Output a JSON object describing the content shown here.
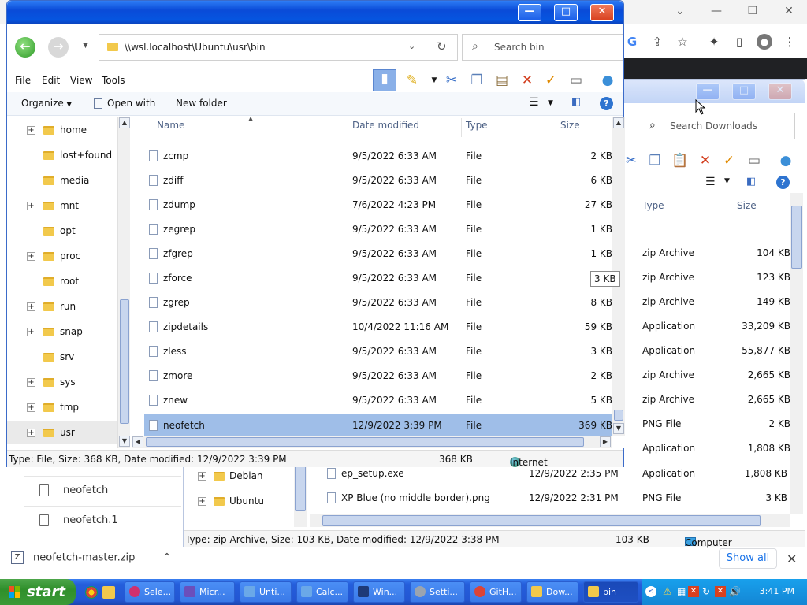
{
  "chrome": {
    "download_file": "neofetch-master.zip",
    "show_all": "Show all",
    "list": [
      "neofetch",
      "neofetch.1"
    ],
    "toolbar_icons": [
      "google-icon",
      "share-icon",
      "star-icon",
      "extensions-icon",
      "sidepanel-icon",
      "profile-icon",
      "menu-icon"
    ]
  },
  "win1": {
    "address": "\\\\wsl.localhost\\Ubuntu\\usr\\bin",
    "search_placeholder": "Search bin",
    "menu": [
      "File",
      "Edit",
      "View",
      "Tools"
    ],
    "organize": "Organize",
    "open_with": "Open with",
    "new_folder": "New folder",
    "tree": [
      {
        "label": "home",
        "expand": "+"
      },
      {
        "label": "lost+found",
        "expand": ""
      },
      {
        "label": "media",
        "expand": ""
      },
      {
        "label": "mnt",
        "expand": "+"
      },
      {
        "label": "opt",
        "expand": ""
      },
      {
        "label": "proc",
        "expand": "+"
      },
      {
        "label": "root",
        "expand": ""
      },
      {
        "label": "run",
        "expand": "+"
      },
      {
        "label": "snap",
        "expand": "+"
      },
      {
        "label": "srv",
        "expand": ""
      },
      {
        "label": "sys",
        "expand": "+"
      },
      {
        "label": "tmp",
        "expand": "+"
      },
      {
        "label": "usr",
        "expand": "+"
      }
    ],
    "columns": {
      "name": "Name",
      "date": "Date modified",
      "type": "Type",
      "size": "Size"
    },
    "files": [
      {
        "name": "zcmp",
        "date": "9/5/2022 6:33 AM",
        "type": "File",
        "size": "2 KB"
      },
      {
        "name": "zdiff",
        "date": "9/5/2022 6:33 AM",
        "type": "File",
        "size": "6 KB"
      },
      {
        "name": "zdump",
        "date": "7/6/2022 4:23 PM",
        "type": "File",
        "size": "27 KB"
      },
      {
        "name": "zegrep",
        "date": "9/5/2022 6:33 AM",
        "type": "File",
        "size": "1 KB"
      },
      {
        "name": "zfgrep",
        "date": "9/5/2022 6:33 AM",
        "type": "File",
        "size": "1 KB"
      },
      {
        "name": "zforce",
        "date": "9/5/2022 6:33 AM",
        "type": "File",
        "size": ""
      },
      {
        "name": "zgrep",
        "date": "9/5/2022 6:33 AM",
        "type": "File",
        "size": "8 KB"
      },
      {
        "name": "zipdetails",
        "date": "10/4/2022 11:16 AM",
        "type": "File",
        "size": "59 KB"
      },
      {
        "name": "zless",
        "date": "9/5/2022 6:33 AM",
        "type": "File",
        "size": "3 KB"
      },
      {
        "name": "zmore",
        "date": "9/5/2022 6:33 AM",
        "type": "File",
        "size": "2 KB"
      },
      {
        "name": "znew",
        "date": "9/5/2022 6:33 AM",
        "type": "File",
        "size": "5 KB"
      },
      {
        "name": "neofetch",
        "date": "12/9/2022 3:39 PM",
        "type": "File",
        "size": "369 KB"
      }
    ],
    "tooltip": "3 KB",
    "status_text": "Type: File, Size: 368 KB, Date modified: 12/9/2022 3:39 PM",
    "status_size": "368 KB",
    "status_zone": "Internet"
  },
  "win2": {
    "search_placeholder": "Search Downloads",
    "col_type": "Type",
    "col_size": "Size",
    "rows": [
      {
        "type": "zip Archive",
        "size": "104 KB"
      },
      {
        "type": "zip Archive",
        "size": "123 KB"
      },
      {
        "type": "zip Archive",
        "size": "149 KB"
      },
      {
        "type": "Application",
        "size": "33,209 KB"
      },
      {
        "type": "Application",
        "size": "55,877 KB"
      },
      {
        "type": "zip Archive",
        "size": "2,665 KB"
      },
      {
        "type": "zip Archive",
        "size": "2,665 KB"
      },
      {
        "type": "PNG File",
        "size": "2 KB"
      },
      {
        "type": "Application",
        "size": "1,808 KB"
      }
    ],
    "files_full": [
      {
        "name": "ep_setup.exe",
        "date": "12/9/2022 2:35 PM",
        "type": "Application",
        "size": "1,808 KB"
      },
      {
        "name": "XP Blue (no middle border).png",
        "date": "12/9/2022 2:31 PM",
        "type": "PNG File",
        "size": "3 KB"
      }
    ],
    "tree": [
      "Debian",
      "Ubuntu"
    ],
    "status_text": "Type: zip Archive, Size: 103 KB, Date modified: 12/9/2022 3:38 PM",
    "status_size": "103 KB",
    "status_zone": "Computer"
  },
  "taskbar": {
    "start": "start",
    "tasks": [
      "Sele...",
      "Micr...",
      "Unti...",
      "Calc...",
      "Win...",
      "Setti...",
      "GitH...",
      "Dow...",
      "bin"
    ],
    "clock": "3:41 PM"
  }
}
